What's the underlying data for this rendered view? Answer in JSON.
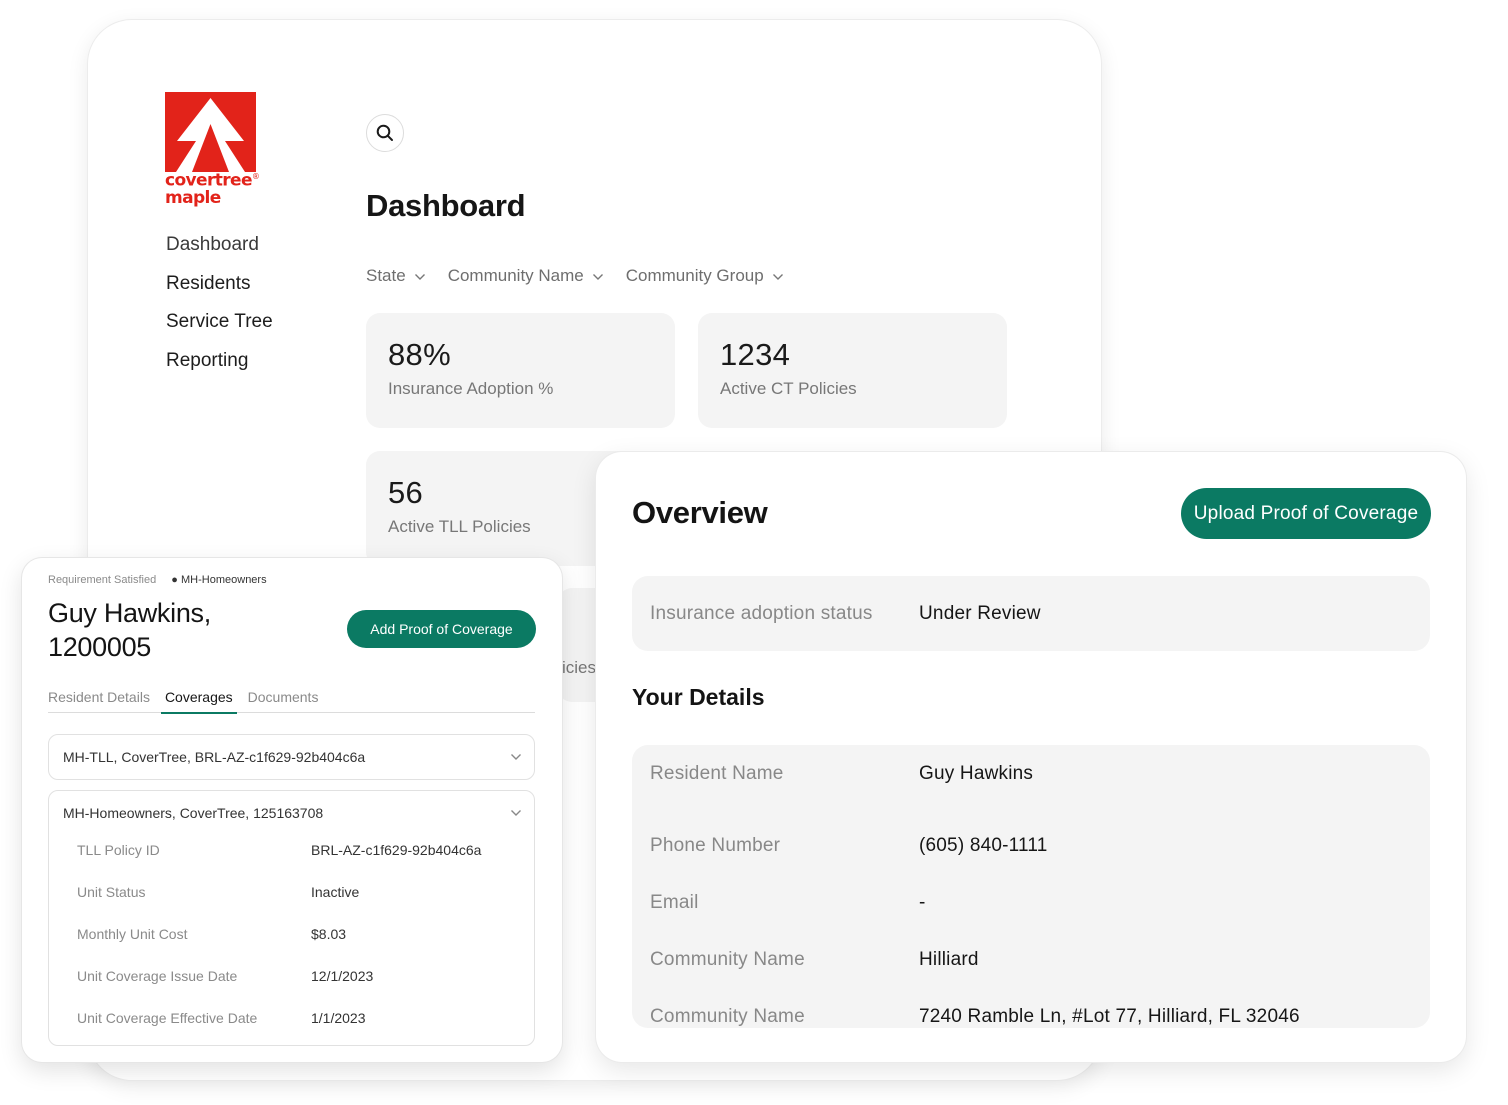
{
  "brand": {
    "line1": "covertree",
    "line2": "maple",
    "accent": "#e2231a",
    "primary": "#0b7a63"
  },
  "sidebar": {
    "items": [
      {
        "label": "Dashboard"
      },
      {
        "label": "Residents"
      },
      {
        "label": "Service Tree"
      },
      {
        "label": "Reporting"
      }
    ]
  },
  "header": {
    "search_icon": "search-icon",
    "title": "Dashboard"
  },
  "filters": [
    {
      "label": "State"
    },
    {
      "label": "Community Name"
    },
    {
      "label": "Community Group"
    }
  ],
  "stats": [
    {
      "value": "88%",
      "label": "Insurance Adoption %"
    },
    {
      "value": "1234",
      "label": "Active CT Policies"
    },
    {
      "value": "56",
      "label": "Active TLL Policies"
    }
  ],
  "hidden_fragment": "icies",
  "overview": {
    "title": "Overview",
    "upload_label": "Upload Proof of Coverage",
    "status": {
      "label": "Insurance adoption status",
      "value": "Under Review"
    },
    "details_title": "Your Details",
    "details": [
      {
        "label": "Resident Name",
        "value": "Guy Hawkins"
      },
      {
        "label": "Phone Number",
        "value": "(605) 840-1111"
      },
      {
        "label": "Email",
        "value": "-"
      },
      {
        "label": "Community Name",
        "value": "Hilliard"
      },
      {
        "label": "Community Name",
        "value": "7240 Ramble Ln, #Lot 77, Hilliard, FL 32046"
      }
    ]
  },
  "resident": {
    "requirement": "Requirement Satisfied",
    "policy_type": "MH-Homeowners",
    "name_line1": "Guy Hawkins,",
    "name_line2": "1200005",
    "add_label": "Add Proof of Coverage",
    "tabs": [
      {
        "label": "Resident Details"
      },
      {
        "label": "Coverages"
      },
      {
        "label": "Documents"
      }
    ],
    "active_tab": "Coverages",
    "coverages": [
      {
        "title": "MH-TLL, CoverTree, BRL-AZ-c1f629-92b404c6a"
      },
      {
        "title": "MH-Homeowners, CoverTree, 125163708",
        "rows": [
          {
            "label": "TLL Policy ID",
            "value": "BRL-AZ-c1f629-92b404c6a"
          },
          {
            "label": "Unit Status",
            "value": "Inactive"
          },
          {
            "label": "Monthly Unit Cost",
            "value": "$8.03"
          },
          {
            "label": "Unit Coverage Issue Date",
            "value": "12/1/2023"
          },
          {
            "label": "Unit Coverage Effective Date",
            "value": "1/1/2023"
          }
        ]
      }
    ]
  }
}
